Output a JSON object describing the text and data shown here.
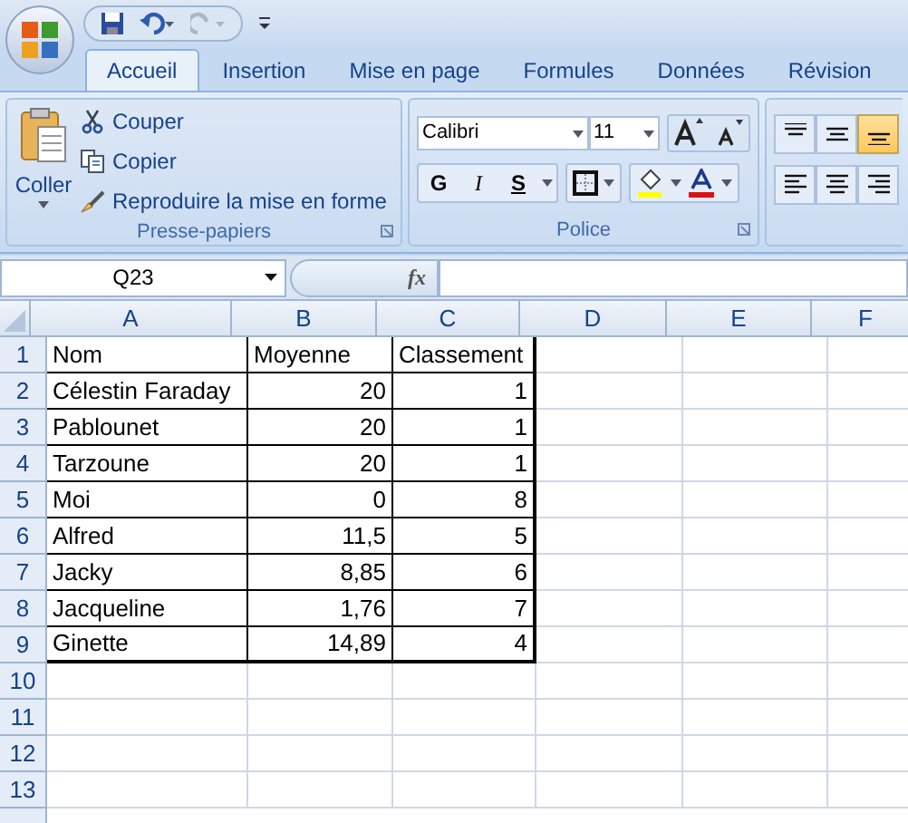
{
  "ribbon_tabs": [
    {
      "label": "Accueil",
      "selected": true
    },
    {
      "label": "Insertion",
      "selected": false
    },
    {
      "label": "Mise en page",
      "selected": false
    },
    {
      "label": "Formules",
      "selected": false
    },
    {
      "label": "Données",
      "selected": false
    },
    {
      "label": "Révision",
      "selected": false
    }
  ],
  "clipboard_group": {
    "title": "Presse-papiers",
    "paste": "Coller",
    "actions": [
      {
        "kind": "cut",
        "label": "Couper"
      },
      {
        "kind": "copy",
        "label": "Copier"
      },
      {
        "kind": "format",
        "label": "Reproduire la mise en forme"
      }
    ]
  },
  "font_group": {
    "title": "Police",
    "font_name": "Calibri",
    "font_size": "11",
    "style_buttons": [
      {
        "label": "G",
        "kind": "bold"
      },
      {
        "label": "I",
        "kind": "italic"
      },
      {
        "label": "S",
        "kind": "underline"
      }
    ]
  },
  "alignment_buttons": [
    {
      "kind": "top",
      "selected": false
    },
    {
      "kind": "middle",
      "selected": false
    },
    {
      "kind": "bottom",
      "selected": true
    },
    {
      "kind": "left",
      "selected": false
    },
    {
      "kind": "center",
      "selected": false
    },
    {
      "kind": "right",
      "selected": false
    }
  ],
  "formula_bar": {
    "name_box": "Q23",
    "function_label": "fx"
  },
  "columns": [
    "A",
    "B",
    "C",
    "D",
    "E",
    "F"
  ],
  "row_numbers": [
    "1",
    "2",
    "3",
    "4",
    "5",
    "6",
    "7",
    "8",
    "9",
    "10",
    "11",
    "12",
    "13"
  ],
  "rows": [
    [
      "Nom",
      "Moyenne",
      "Classement"
    ],
    [
      "Célestin Faraday",
      "20",
      "1"
    ],
    [
      "Pablounet",
      "20",
      "1"
    ],
    [
      "Tarzoune",
      "20",
      "1"
    ],
    [
      "Moi",
      "0",
      "8"
    ],
    [
      "Alfred",
      "11,5",
      "5"
    ],
    [
      "Jacky",
      "8,85",
      "6"
    ],
    [
      "Jacqueline",
      "1,76",
      "7"
    ],
    [
      "Ginette",
      "14,89",
      "4"
    ]
  ]
}
